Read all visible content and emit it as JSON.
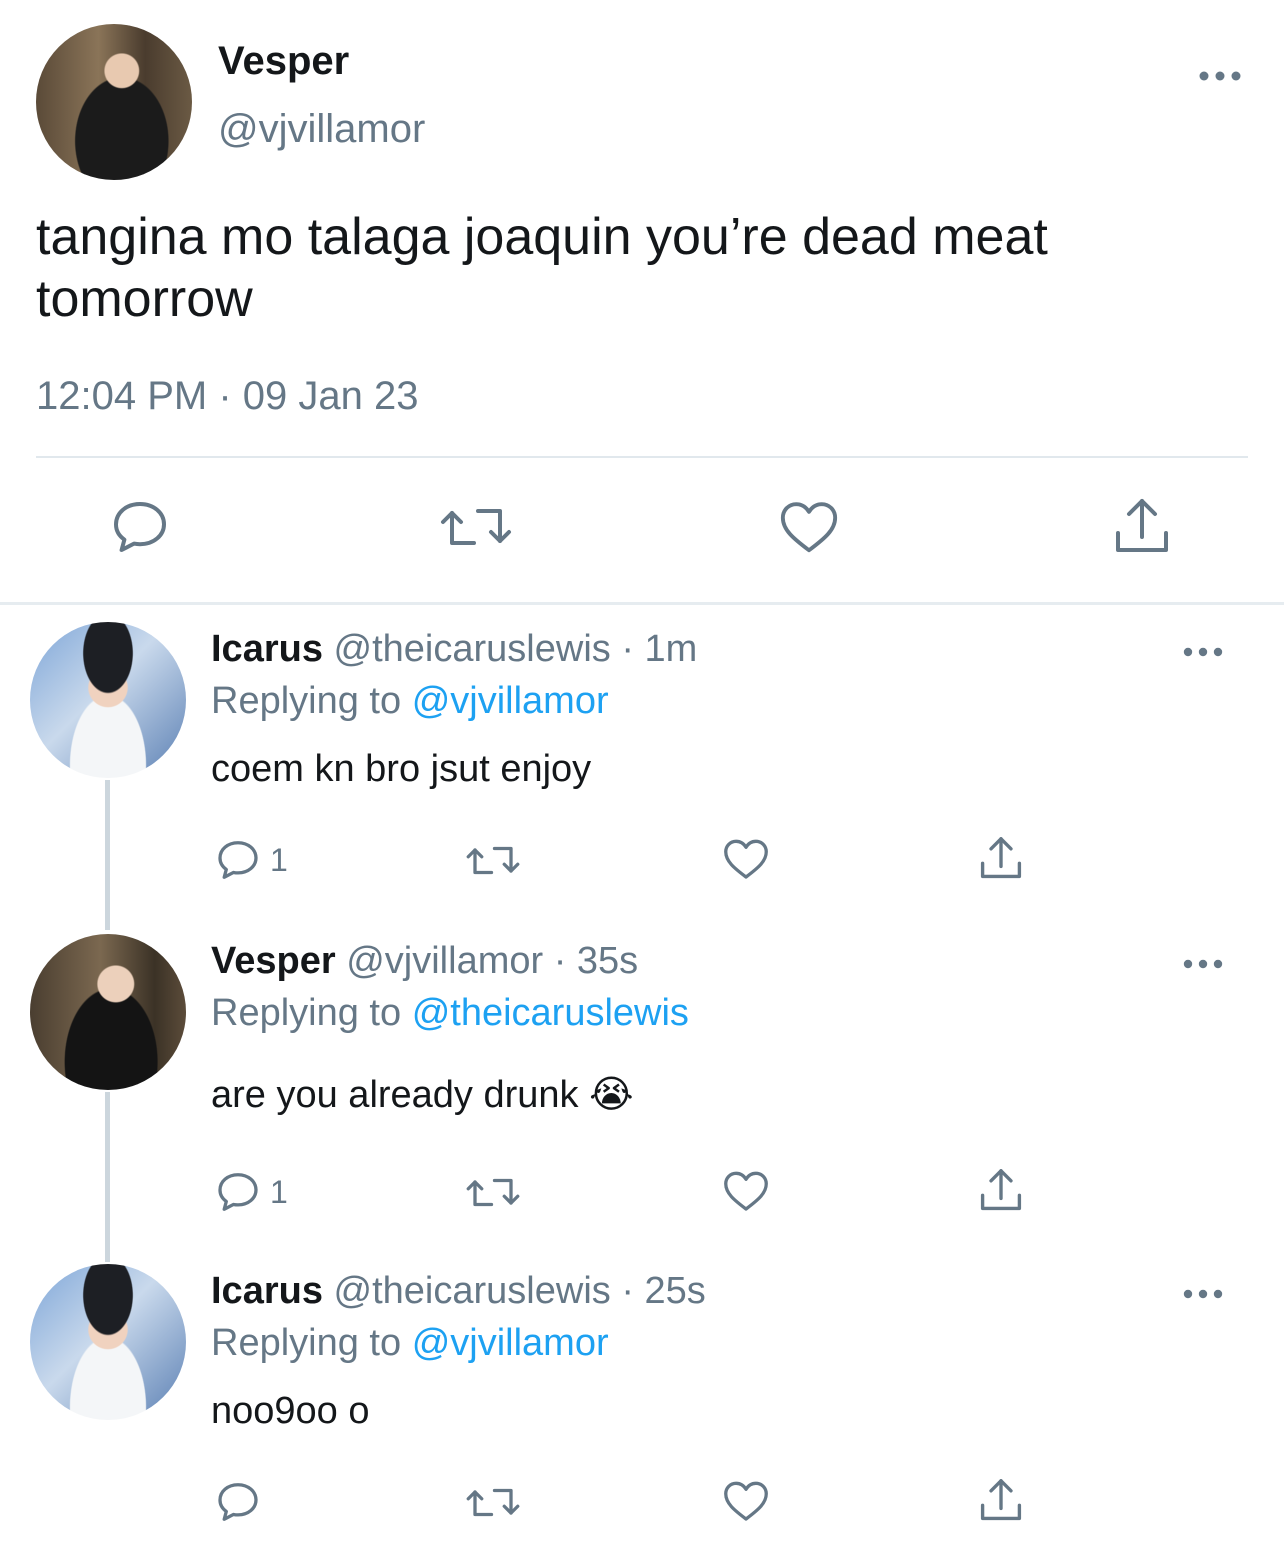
{
  "main_tweet": {
    "name": "Vesper",
    "handle": "@vjvillamor",
    "text": "tangina mo talaga joaquin you’re dead meat tomorrow",
    "time": "12:04 PM · 09 Jan 23"
  },
  "replies": [
    {
      "name": "Icarus",
      "meta": "@theicaruslewis · 1m",
      "replying_prefix": "Replying to",
      "replying_to": "@vjvillamor",
      "text": "coem kn bro jsut enjoy",
      "reply_count": "1"
    },
    {
      "name": "Vesper",
      "meta": "@vjvillamor · 35s",
      "replying_prefix": "Replying to",
      "replying_to": "@theicaruslewis",
      "text": "are you already drunk",
      "emoji": "😭",
      "reply_count": "1"
    },
    {
      "name": "Icarus",
      "meta": "@theicaruslewis · 25s",
      "replying_prefix": "Replying to",
      "replying_to": "@vjvillamor",
      "text": "noo9oo o",
      "reply_count": ""
    }
  ],
  "icons": [
    "reply-icon",
    "retweet-icon",
    "like-icon",
    "share-icon",
    "more-icon"
  ],
  "colors": {
    "text": "#14171a",
    "secondary": "#657786",
    "link": "#1da1f2",
    "divider": "#e1e8ed"
  }
}
